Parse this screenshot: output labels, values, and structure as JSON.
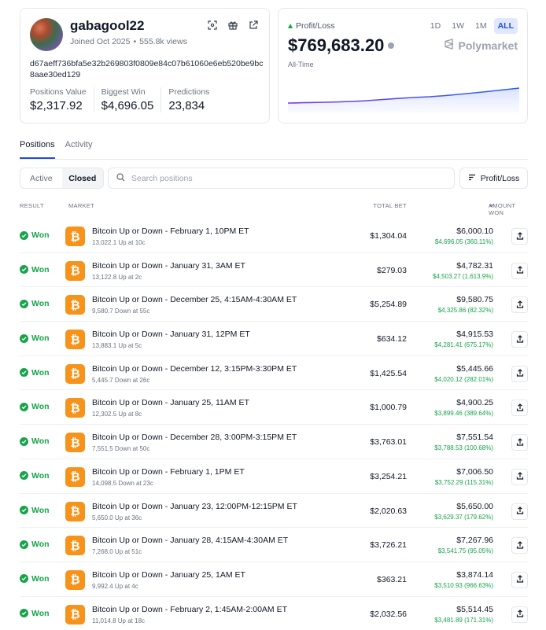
{
  "profile": {
    "username": "gabagool22",
    "joined": "Joined Oct 2025",
    "views": "555.8k views",
    "address": "d67aeff736bfa5e32b269803f0809e84c07b61060e6eb520be9bc8aae30ed129",
    "stats": [
      {
        "label": "Positions Value",
        "value": "$2,317.92"
      },
      {
        "label": "Biggest Win",
        "value": "$4,696.05"
      },
      {
        "label": "Predictions",
        "value": "23,834"
      }
    ]
  },
  "pnl": {
    "label": "Profit/Loss",
    "value": "$769,683.20",
    "period": "All-Time",
    "ranges": [
      "1D",
      "1W",
      "1M",
      "ALL"
    ],
    "active_range": "ALL",
    "brand": "Polymarket",
    "accent": "#16a34a"
  },
  "tabs": {
    "positions": "Positions",
    "activity": "Activity"
  },
  "filters": {
    "active": "Active",
    "closed": "Closed",
    "search_placeholder": "Search positions",
    "sort_label": "Profit/Loss"
  },
  "table": {
    "headers": {
      "result": "RESULT",
      "market": "MARKET",
      "total_bet": "TOTAL BET",
      "amount_won": "AMOUNT WON"
    },
    "rows": [
      {
        "result": "Won",
        "title": "Bitcoin Up or Down - February 1, 10PM ET",
        "subtitle": "13,022.1 Up at 10c",
        "bet": "$1,304.04",
        "won": "$6,000.10",
        "pnl": "$4,696.05 (360.11%)"
      },
      {
        "result": "Won",
        "title": "Bitcoin Up or Down - January 31, 3AM ET",
        "subtitle": "13,122.8 Up at 2c",
        "bet": "$279.03",
        "won": "$4,782.31",
        "pnl": "$4,503.27 (1,613.9%)"
      },
      {
        "result": "Won",
        "title": "Bitcoin Up or Down - December 25, 4:15AM-4:30AM ET",
        "subtitle": "9,580.7 Down at 55c",
        "bet": "$5,254.89",
        "won": "$9,580.75",
        "pnl": "$4,325.86 (82.32%)"
      },
      {
        "result": "Won",
        "title": "Bitcoin Up or Down - January 31, 12PM ET",
        "subtitle": "13,883.1 Up at 5c",
        "bet": "$634.12",
        "won": "$4,915.53",
        "pnl": "$4,281.41 (675.17%)"
      },
      {
        "result": "Won",
        "title": "Bitcoin Up or Down - December 12, 3:15PM-3:30PM ET",
        "subtitle": "5,445.7 Down at 26c",
        "bet": "$1,425.54",
        "won": "$5,445.66",
        "pnl": "$4,020.12 (282.01%)"
      },
      {
        "result": "Won",
        "title": "Bitcoin Up or Down - January 25, 11AM ET",
        "subtitle": "12,302.5 Up at 8c",
        "bet": "$1,000.79",
        "won": "$4,900.25",
        "pnl": "$3,899.46 (389.64%)"
      },
      {
        "result": "Won",
        "title": "Bitcoin Up or Down - December 28, 3:00PM-3:15PM ET",
        "subtitle": "7,551.5 Down at 50c",
        "bet": "$3,763.01",
        "won": "$7,551.54",
        "pnl": "$3,788.53 (100.68%)"
      },
      {
        "result": "Won",
        "title": "Bitcoin Up or Down - February 1, 1PM ET",
        "subtitle": "14,098.5 Down at 23c",
        "bet": "$3,254.21",
        "won": "$7,006.50",
        "pnl": "$3,752.29 (115.31%)"
      },
      {
        "result": "Won",
        "title": "Bitcoin Up or Down - January 23, 12:00PM-12:15PM ET",
        "subtitle": "5,650.0 Up at 36c",
        "bet": "$2,020.63",
        "won": "$5,650.00",
        "pnl": "$3,629.37 (179.62%)"
      },
      {
        "result": "Won",
        "title": "Bitcoin Up or Down - January 28, 4:15AM-4:30AM ET",
        "subtitle": "7,268.0 Up at 51c",
        "bet": "$3,726.21",
        "won": "$7,267.96",
        "pnl": "$3,541.75 (95.05%)"
      },
      {
        "result": "Won",
        "title": "Bitcoin Up or Down - January 25, 1AM ET",
        "subtitle": "9,992.4 Up at 4c",
        "bet": "$363.21",
        "won": "$3,874.14",
        "pnl": "$3,510.93 (966.63%)"
      },
      {
        "result": "Won",
        "title": "Bitcoin Up or Down - February 2, 1:45AM-2:00AM ET",
        "subtitle": "11,014.8 Up at 18c",
        "bet": "$2,032.56",
        "won": "$5,514.45",
        "pnl": "$3,481.89 (171.31%)"
      }
    ]
  }
}
